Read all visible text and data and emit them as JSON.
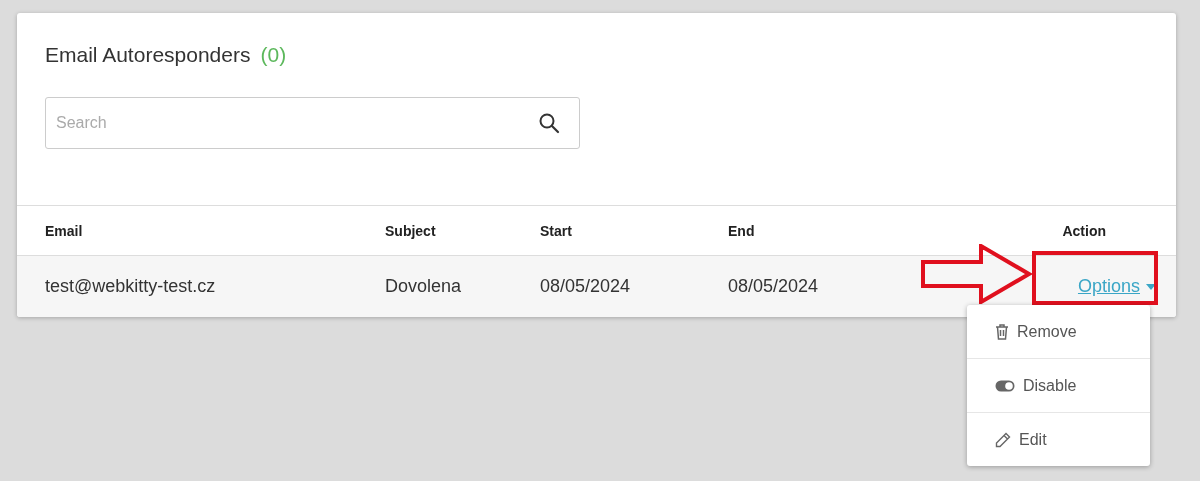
{
  "title": "Email Autoresponders",
  "count": "(0)",
  "search": {
    "placeholder": "Search"
  },
  "table": {
    "columns": [
      "Email",
      "Subject",
      "Start",
      "End",
      "Action"
    ],
    "rows": [
      {
        "cells": [
          "test@webkitty-test.cz",
          "Dovolena",
          "08/05/2024",
          "08/05/2024"
        ],
        "action": "Options"
      }
    ]
  },
  "menu": [
    {
      "kind": "remove",
      "label": "Remove"
    },
    {
      "kind": "disable",
      "label": "Disable"
    },
    {
      "kind": "edit",
      "label": "Edit"
    }
  ]
}
